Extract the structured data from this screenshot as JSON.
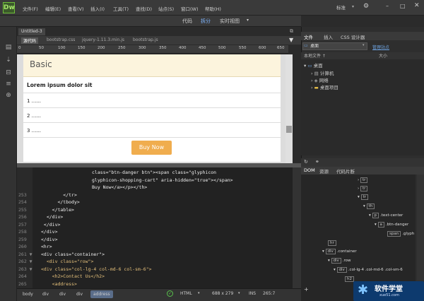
{
  "app": {
    "logo": "Dw",
    "menus": [
      "文件(F)",
      "编辑(E)",
      "查看(V)",
      "插入(I)",
      "工具(T)",
      "查找(D)",
      "站点(S)",
      "窗口(W)",
      "帮助(H)"
    ],
    "layout": "标准",
    "gear": "⚙"
  },
  "toolbar": {
    "code": "代码",
    "split": "拆分",
    "live": "实时视图"
  },
  "doc": {
    "tab": "Untitled-3",
    "source": "源代码",
    "related": [
      "bootstrap.css",
      "jquery-1.11.3.min.js",
      "bootstrap.js"
    ]
  },
  "ruler": [
    "0",
    "50",
    "100",
    "150",
    "200",
    "250",
    "300",
    "350",
    "400",
    "450",
    "500",
    "550",
    "600",
    "650"
  ],
  "design": {
    "hero": "Basic",
    "lorem": "Lorem ipsum dolor sit",
    "rows": [
      "1 ......",
      "2 ......",
      "3 ......"
    ],
    "button": "Buy Now"
  },
  "code": {
    "lines": [
      {
        "n": "",
        "t": "class=\"btn-danger btn\"><span class=\"glyphicon"
      },
      {
        "n": "",
        "t": "glyphicon-shopping-cart\" aria-hidden=\"true\"></span>"
      },
      {
        "n": "",
        "t": "Buy Now</a></p></th>"
      },
      {
        "n": "253",
        "t": "        </tr>"
      },
      {
        "n": "254",
        "t": "      </tbody>"
      },
      {
        "n": "255",
        "t": "    </table>"
      },
      {
        "n": "256",
        "t": "  </div>"
      },
      {
        "n": "257",
        "t": " </div>"
      },
      {
        "n": "258",
        "t": "</div>"
      },
      {
        "n": "259",
        "t": "</div>"
      },
      {
        "n": "260",
        "t": "<hr>"
      },
      {
        "n": "261 ▼",
        "t": "<div class=\"container\">"
      },
      {
        "n": "262 ▼",
        "t": "  <div class=\"row\">"
      },
      {
        "n": "263 ▼",
        "t": "<div class=\"col-lg-4 col-md-6 col-sm-6\">"
      },
      {
        "n": "264",
        "t": "    <h2>Contact Us</h2>"
      },
      {
        "n": "265",
        "t": "    <address>"
      }
    ]
  },
  "status": {
    "crumbs": [
      "body",
      "div",
      "div",
      "div",
      "address"
    ],
    "lang": "HTML",
    "size": "688 x 279",
    "ins": "INS",
    "pos": "265:7"
  },
  "files": {
    "tabs": [
      "文件",
      "插入",
      "CSS 设计器"
    ],
    "site": "桌面",
    "manage": "管理站点",
    "localfiles": "本地文件 ↑",
    "size": "大小",
    "tree": [
      "桌面",
      "计算机",
      "网络",
      "桌面项目"
    ]
  },
  "dom": {
    "tabs": [
      "DOM",
      "资源",
      "代码片断"
    ],
    "nodes": [
      "tr",
      "tr",
      "tr",
      "th",
      "p",
      ".text-center",
      "a",
      ".btn-danger",
      "span",
      ".glyph",
      "hr",
      "div",
      ".container",
      "div",
      ".row",
      "div",
      ".col-lg-4 .col-md-6 .col-sm-6",
      "h2"
    ]
  },
  "watermark": {
    "title": "软件学堂",
    "url": "xue51.com"
  }
}
